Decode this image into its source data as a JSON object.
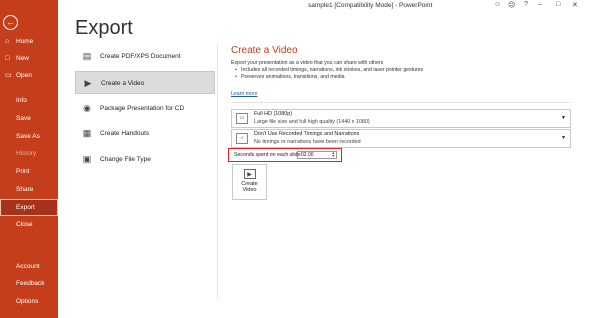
{
  "window": {
    "title": "sample1 [Compatibility Mode] - PowerPoint"
  },
  "sidebar": {
    "back_icon": "back-arrow-icon",
    "items": [
      {
        "label": "Home",
        "icon": "home-icon"
      },
      {
        "label": "New",
        "icon": "new-file-icon"
      },
      {
        "label": "Open",
        "icon": "folder-icon"
      },
      {
        "label": "Info"
      },
      {
        "label": "Save"
      },
      {
        "label": "Save As"
      },
      {
        "label": "History",
        "muted": true
      },
      {
        "label": "Print"
      },
      {
        "label": "Share"
      },
      {
        "label": "Export",
        "active": true
      },
      {
        "label": "Close"
      },
      {
        "label": "Account"
      },
      {
        "label": "Feedback"
      },
      {
        "label": "Options"
      }
    ]
  },
  "page": {
    "title": "Export"
  },
  "export_options": [
    {
      "label": "Create PDF/XPS Document",
      "icon": "pdf-icon"
    },
    {
      "label": "Create a Video",
      "icon": "video-icon",
      "selected": true
    },
    {
      "label": "Package Presentation for CD",
      "icon": "cd-icon"
    },
    {
      "label": "Create Handouts",
      "icon": "handouts-icon"
    },
    {
      "label": "Change File Type",
      "icon": "file-type-icon"
    }
  ],
  "video": {
    "heading": "Create a Video",
    "intro": "Export your presentation as a video that you can share with others",
    "bullets": [
      "Includes all recorded timings, narrations, ink strokes, and laser pointer gestures",
      "Preserves animations, transitions, and media"
    ],
    "learn_more": "Learn more",
    "quality": {
      "line1": "Full HD (1080p)",
      "line2": "Large file size and full high quality (1440 x 1080)"
    },
    "timings": {
      "line1": "Don't Use Recorded Timings and Narrations",
      "line2": "No timings or narrations have been recorded"
    },
    "seconds_label": "Seconds spent on each slide:",
    "seconds_value": "02.00",
    "create_button_line1": "Create",
    "create_button_line2": "Video"
  }
}
